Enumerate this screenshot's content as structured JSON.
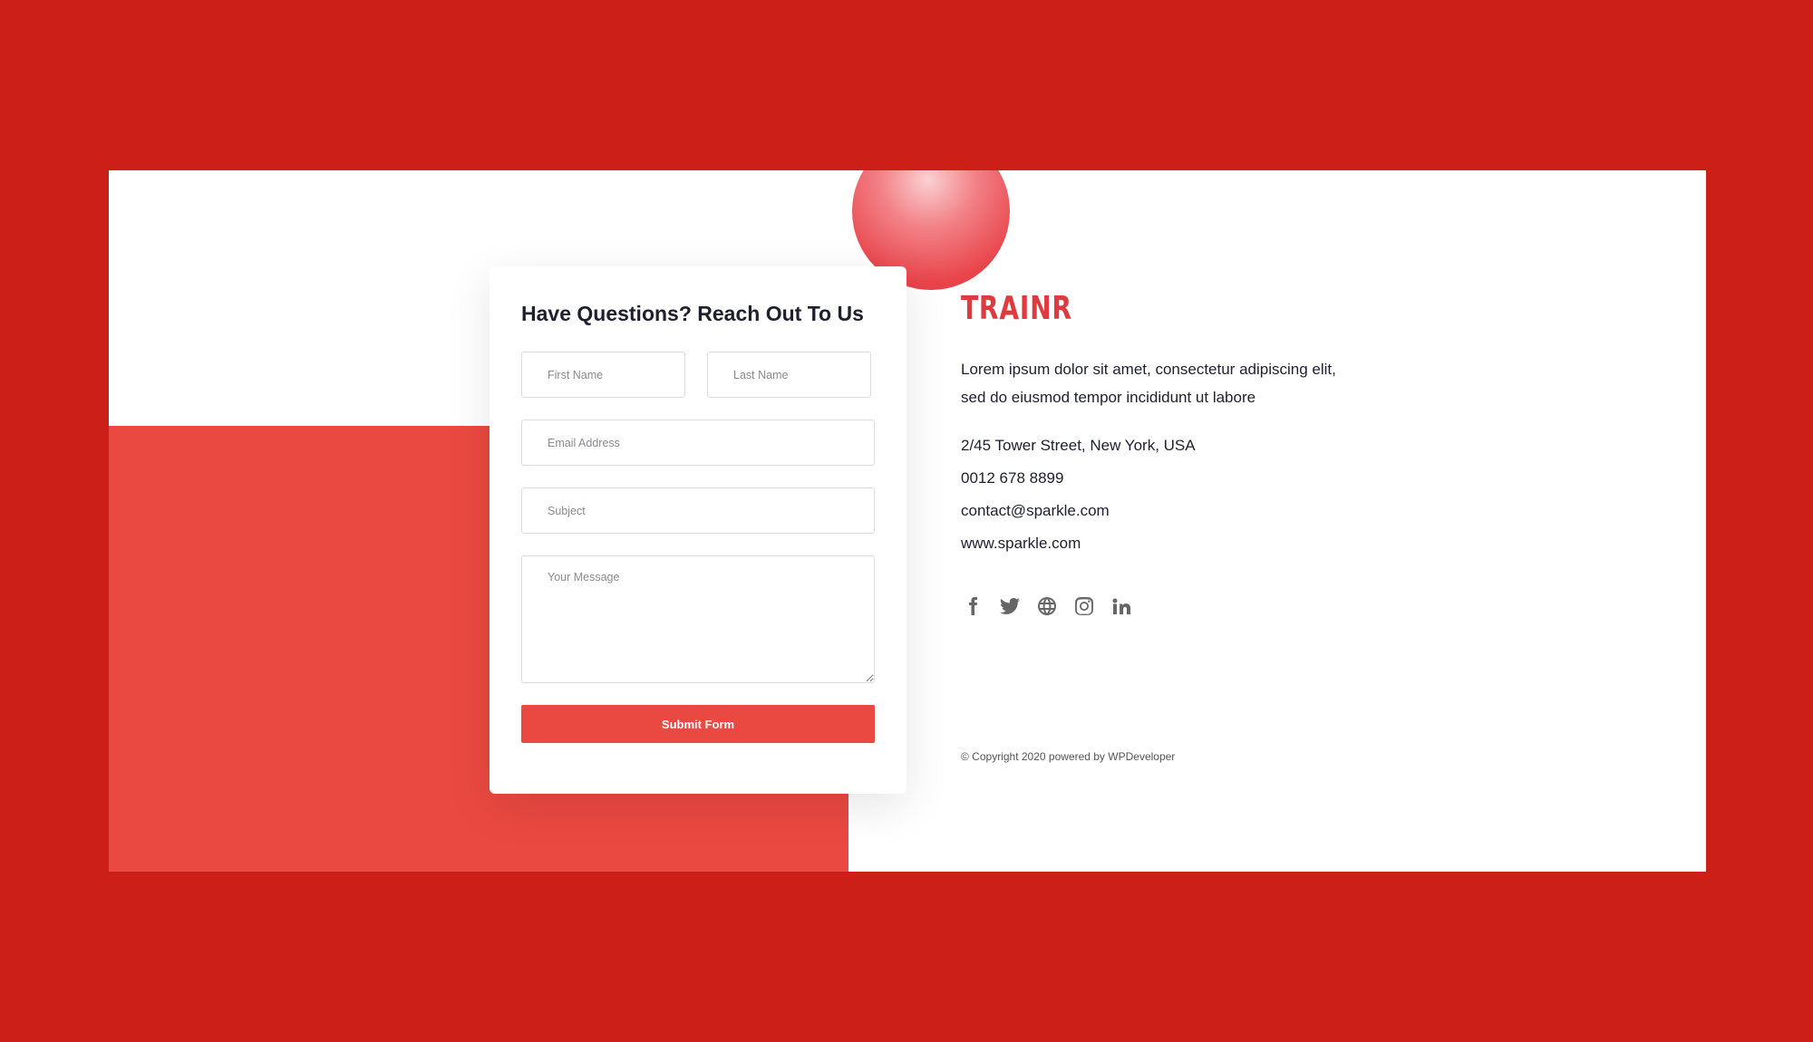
{
  "brand": {
    "logo_text": "TRAINR",
    "accent_color": "#ea4941",
    "frame_color": "#cc1f18"
  },
  "form": {
    "title": "Have Questions? Reach Out To Us",
    "first_name_placeholder": "First Name",
    "last_name_placeholder": "Last Name",
    "email_placeholder": "Email Address",
    "subject_placeholder": "Subject",
    "message_placeholder": "Your Message",
    "submit_label": "Submit Form"
  },
  "info": {
    "description": "Lorem ipsum dolor sit amet, consectetur adipiscing elit, sed do eiusmod tempor incididunt ut labore",
    "address": "2/45 Tower Street, New York, USA",
    "phone": "0012 678 8899",
    "email": "contact@sparkle.com",
    "website": "www.sparkle.com"
  },
  "socials": [
    "facebook-icon",
    "twitter-icon",
    "globe-icon",
    "instagram-icon",
    "linkedin-icon"
  ],
  "footer": {
    "copyright": "© Copyright 2020 powered by WPDeveloper"
  }
}
